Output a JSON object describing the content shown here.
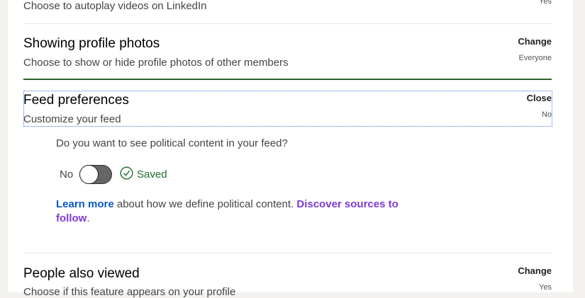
{
  "autoplay": {
    "description": "Choose to autoplay videos on LinkedIn",
    "value": "Yes"
  },
  "profile_photos": {
    "title": "Showing profile photos",
    "description": "Choose to show or hide profile photos of other members",
    "action": "Change",
    "value": "Everyone"
  },
  "feed_preferences": {
    "title": "Feed preferences",
    "description": "Customize your feed",
    "action": "Close",
    "value": "No",
    "question": "Do you want to see political content in your feed?",
    "toggle_label": "No",
    "toggle_on": false,
    "saved_label": "Saved",
    "learn_more": "Learn more",
    "info_text": " about how we define political content. ",
    "discover_line1": "Discover sources to",
    "discover_line2": "follow",
    "period": "."
  },
  "people_also_viewed": {
    "title": "People also viewed",
    "description": "Choose if this feature appears on your profile",
    "action": "Change",
    "value": "Yes"
  },
  "colors": {
    "accent_green": "#2d5f2e",
    "link_blue": "#0a58ca",
    "link_purple": "#7b3ad6"
  }
}
